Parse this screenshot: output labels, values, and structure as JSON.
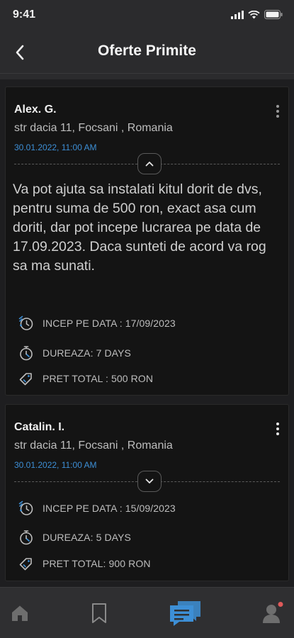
{
  "status_bar": {
    "time": "9:41",
    "icons": [
      "signal-icon",
      "wifi-icon",
      "battery-icon"
    ]
  },
  "header": {
    "title": "Oferte Primite",
    "back_icon": "chevron-left-icon"
  },
  "offers": [
    {
      "name": "Alex. G.",
      "address": "str dacia 11, Focsani , Romania",
      "date": "30.01.2022, 11:00 AM",
      "expanded": true,
      "message": "Va pot ajuta sa instalati kitul dorit de dvs, pentru suma de 500 ron, exact asa cum doriti, dar pot incepe lucrarea pe data de 17.09.2023. Daca sunteti de acord va rog sa ma sunati.",
      "start_label": "INCEP PE DATA : 17/09/2023",
      "duration_label": "DUREAZA:  7 DAYS",
      "price_label": "PRET TOTAL : 500 RON"
    },
    {
      "name": "Catalin. I.",
      "address": "str dacia 11, Focsani , Romania",
      "date": "30.01.2022, 11:00 AM",
      "expanded": false,
      "start_label": "INCEP PE DATA : 15/09/2023",
      "duration_label": "DUREAZA:  5 DAYS",
      "price_label": "PRET TOTAL: 900 RON"
    }
  ],
  "bottom_nav": {
    "items": [
      "home-icon",
      "bookmark-icon",
      "chat-icon",
      "profile-icon"
    ],
    "active": "chat-icon",
    "colors": {
      "active": "#3d8fd6",
      "inactive": "#6e6e6e",
      "badge": "#e05a5a"
    }
  },
  "colors": {
    "accent": "#3d8fd6",
    "background": "#1e1e20",
    "card": "#141414"
  }
}
